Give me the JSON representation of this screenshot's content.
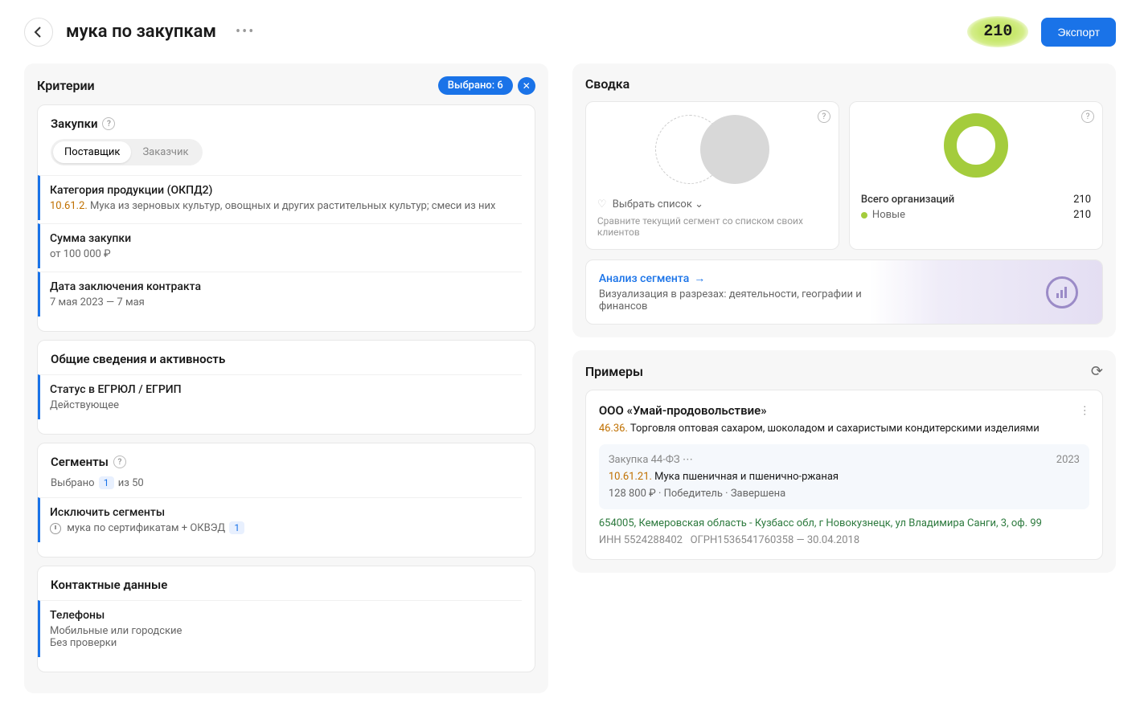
{
  "header": {
    "title": "мука по закупкам",
    "count": "210",
    "export_label": "Экспорт"
  },
  "criteria": {
    "title": "Критерии",
    "selected_label": "Выбрано: 6",
    "purchases": {
      "title": "Закупки",
      "toggle_supplier": "Поставщик",
      "toggle_customer": "Заказчик"
    },
    "items": [
      {
        "label": "Категория продукции (ОКПД2)",
        "code": "10.61.2.",
        "value": " Мука из зерновых культур, овощных и других растительных культур; смеси из них"
      },
      {
        "label": "Сумма закупки",
        "value": "от 100 000 ₽"
      },
      {
        "label": "Дата заключения контракта",
        "value": "7 мая 2023 — 7 мая"
      }
    ],
    "general": {
      "title": "Общие сведения и активность",
      "status_label": "Статус в ЕГРЮЛ / ЕГРИП",
      "status_value": "Действующее"
    },
    "segments": {
      "title": "Сегменты",
      "selected_prefix": "Выбрано",
      "selected_count": "1",
      "selected_suffix": "из 50",
      "exclude_label": "Исключить сегменты",
      "exclude_value": "мука по сертификатам + ОКВЭД",
      "exclude_badge": "1"
    },
    "contacts": {
      "title": "Контактные данные",
      "phones_label": "Телефоны",
      "phones_line1": "Мобильные или городские",
      "phones_line2": "Без проверки"
    }
  },
  "summary": {
    "title": "Сводка",
    "select_list": "Выбрать список",
    "compare_text": "Сравните текущий сегмент со списком своих клиентов",
    "total_label": "Всего организаций",
    "total_value": "210",
    "new_label": "Новые",
    "new_value": "210",
    "analysis_link": "Анализ сегмента",
    "analysis_desc": "Визуализация в разрезах: деятельности, географии и финансов"
  },
  "examples": {
    "title": "Примеры",
    "company": "ООО «Умай-продовольствие»",
    "okved_code": "46.36.",
    "okved_text": " Торговля оптовая сахаром, шоколадом и сахаристыми кондитерскими изделиями",
    "purchase_type": "Закупка 44-ФЗ",
    "purchase_year": "2023",
    "purchase_code": "10.61.21.",
    "purchase_cat": " Мука пшеничная и пшенично-ржаная",
    "purchase_amount": "128 800 ₽",
    "purchase_winner": "Победитель",
    "purchase_status": "Завершена",
    "address": "654005, Кемеровская область - Кузбасс обл, г Новокузнецк, ул Владимира Санги, 3, оф. 99",
    "inn": "ИНН 5524288402",
    "ogrn": "ОГРН1536541760358 — 30.04.2018"
  }
}
